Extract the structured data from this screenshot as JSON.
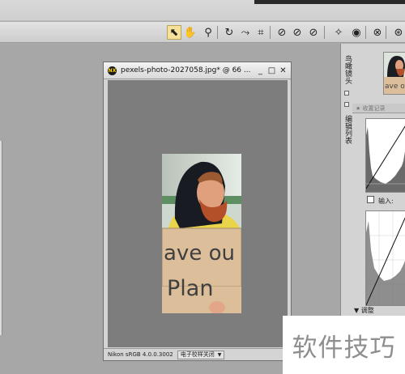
{
  "toolbar": {
    "tools": [
      {
        "icon": "direct-select-arrow-icon",
        "glyph": "⬉",
        "active": true
      },
      {
        "icon": "hand-tool-icon",
        "glyph": "✋"
      },
      {
        "icon": "zoom-tool-icon",
        "glyph": "⚲"
      },
      {
        "icon": "rotate-icon",
        "glyph": "↻"
      },
      {
        "icon": "straighten-icon",
        "glyph": "⤳"
      },
      {
        "icon": "crop-icon",
        "glyph": "⌗"
      },
      {
        "icon": "control-point-icon",
        "glyph": "⊘"
      },
      {
        "icon": "color-control-point-icon",
        "glyph": "⊘"
      },
      {
        "icon": "red-eye-icon",
        "glyph": "⊘"
      },
      {
        "icon": "auto-retouch-icon",
        "glyph": "✧"
      },
      {
        "icon": "eye-preview-icon",
        "glyph": "◉"
      },
      {
        "icon": "link-icon",
        "glyph": "⊗"
      },
      {
        "icon": "extra-tool-icon",
        "glyph": "⊛"
      }
    ]
  },
  "document": {
    "title": "pexels-photo-2027058.jpg*  @  66 ...",
    "app_badge": "NX",
    "minimize": "_",
    "maximize": "□",
    "close": "✕",
    "color_profile": "Nikon sRGB 4.0.0.3002",
    "softproof_label": "电子校样关闭",
    "softproof_arrow": "▼"
  },
  "photo": {
    "sign_line1": "ave ou",
    "sign_line2": "Plan"
  },
  "right_panel": {
    "tab_birdseye": "鸟瞰镜头",
    "tab_edit_list": "编辑列表",
    "panel_header": "★ 收置记录",
    "input_label": "输入:",
    "adjust_label": "▼ 调整"
  },
  "watermark": {
    "text": "软件技巧"
  }
}
